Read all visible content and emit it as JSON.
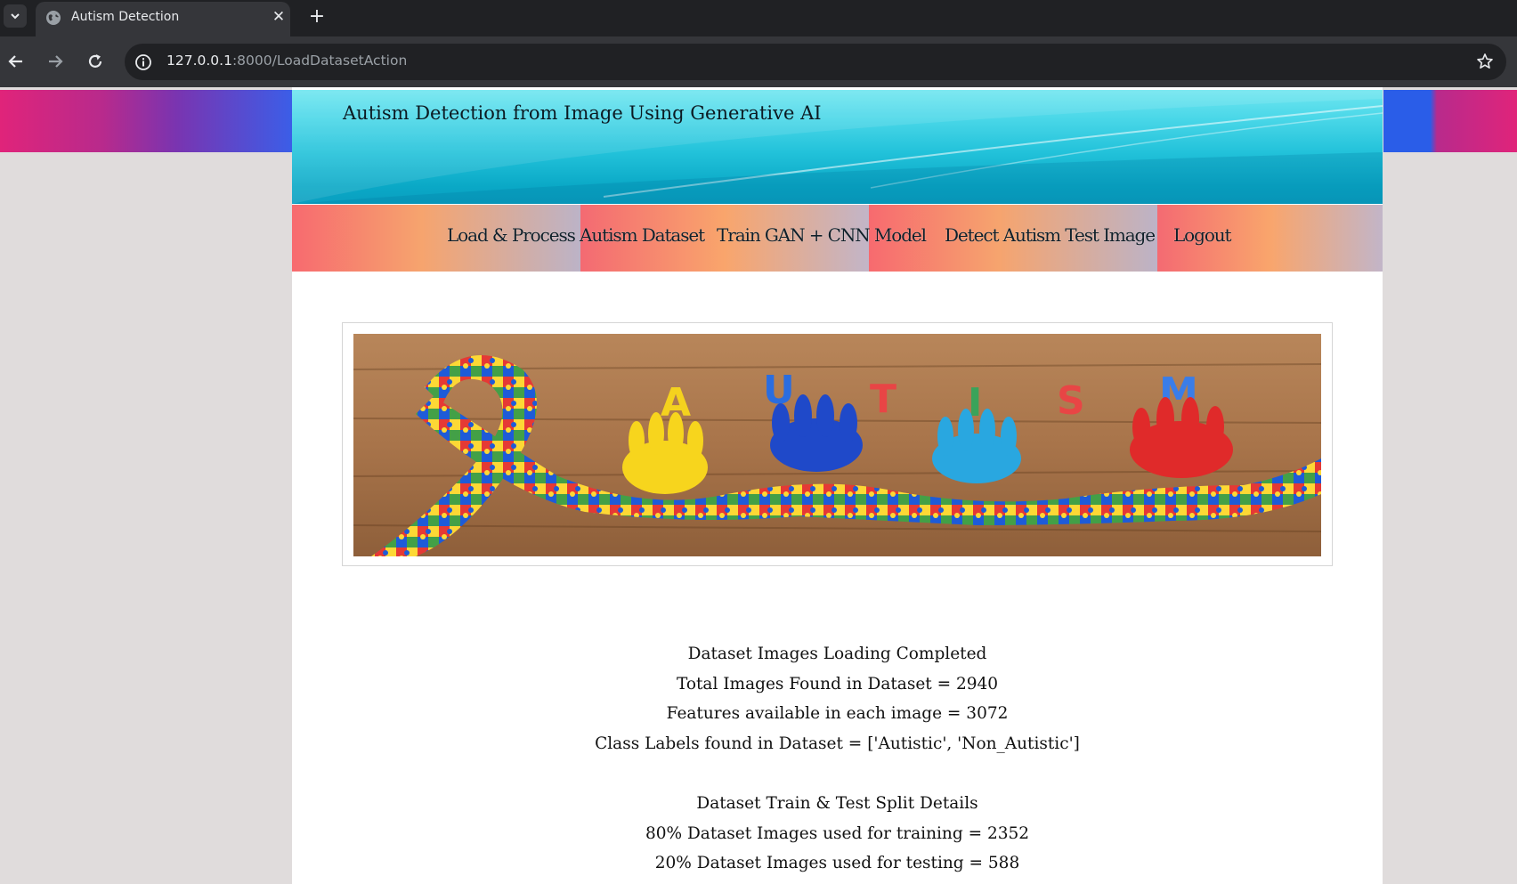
{
  "browser": {
    "tab": {
      "title": "Autism Detection",
      "favicon": "globe-icon"
    },
    "address": {
      "host": "127.0.0.1",
      "path": ":8000/LoadDatasetAction"
    }
  },
  "site": {
    "title": "Autism Detection from Image Using Generative AI",
    "menu": [
      {
        "label": "Load & Process Autism Dataset"
      },
      {
        "label": "Train GAN + CNN Model"
      },
      {
        "label": "Detect Autism Test Image"
      },
      {
        "label": "Logout"
      }
    ]
  },
  "banner": {
    "letters": [
      "A",
      "U",
      "T",
      "I",
      "S",
      "M"
    ]
  },
  "results": {
    "loading": [
      "Dataset Images Loading Completed",
      "Total Images Found in Dataset = 2940",
      "Features available in each image = 3072",
      "Class Labels found in Dataset = ['Autistic', 'Non_Autistic']"
    ],
    "split": [
      "Dataset Train & Test Split Details",
      "80% Dataset Images used for training = 2352",
      "20% Dataset Images used for testing = 588"
    ]
  },
  "colors": {
    "header_cyan": "#22c2da",
    "menu_coral": "#f76a6f",
    "menu_peach": "#f6a46e",
    "page_bg": "#e0dcdc",
    "chrome_dark": "#202124"
  }
}
